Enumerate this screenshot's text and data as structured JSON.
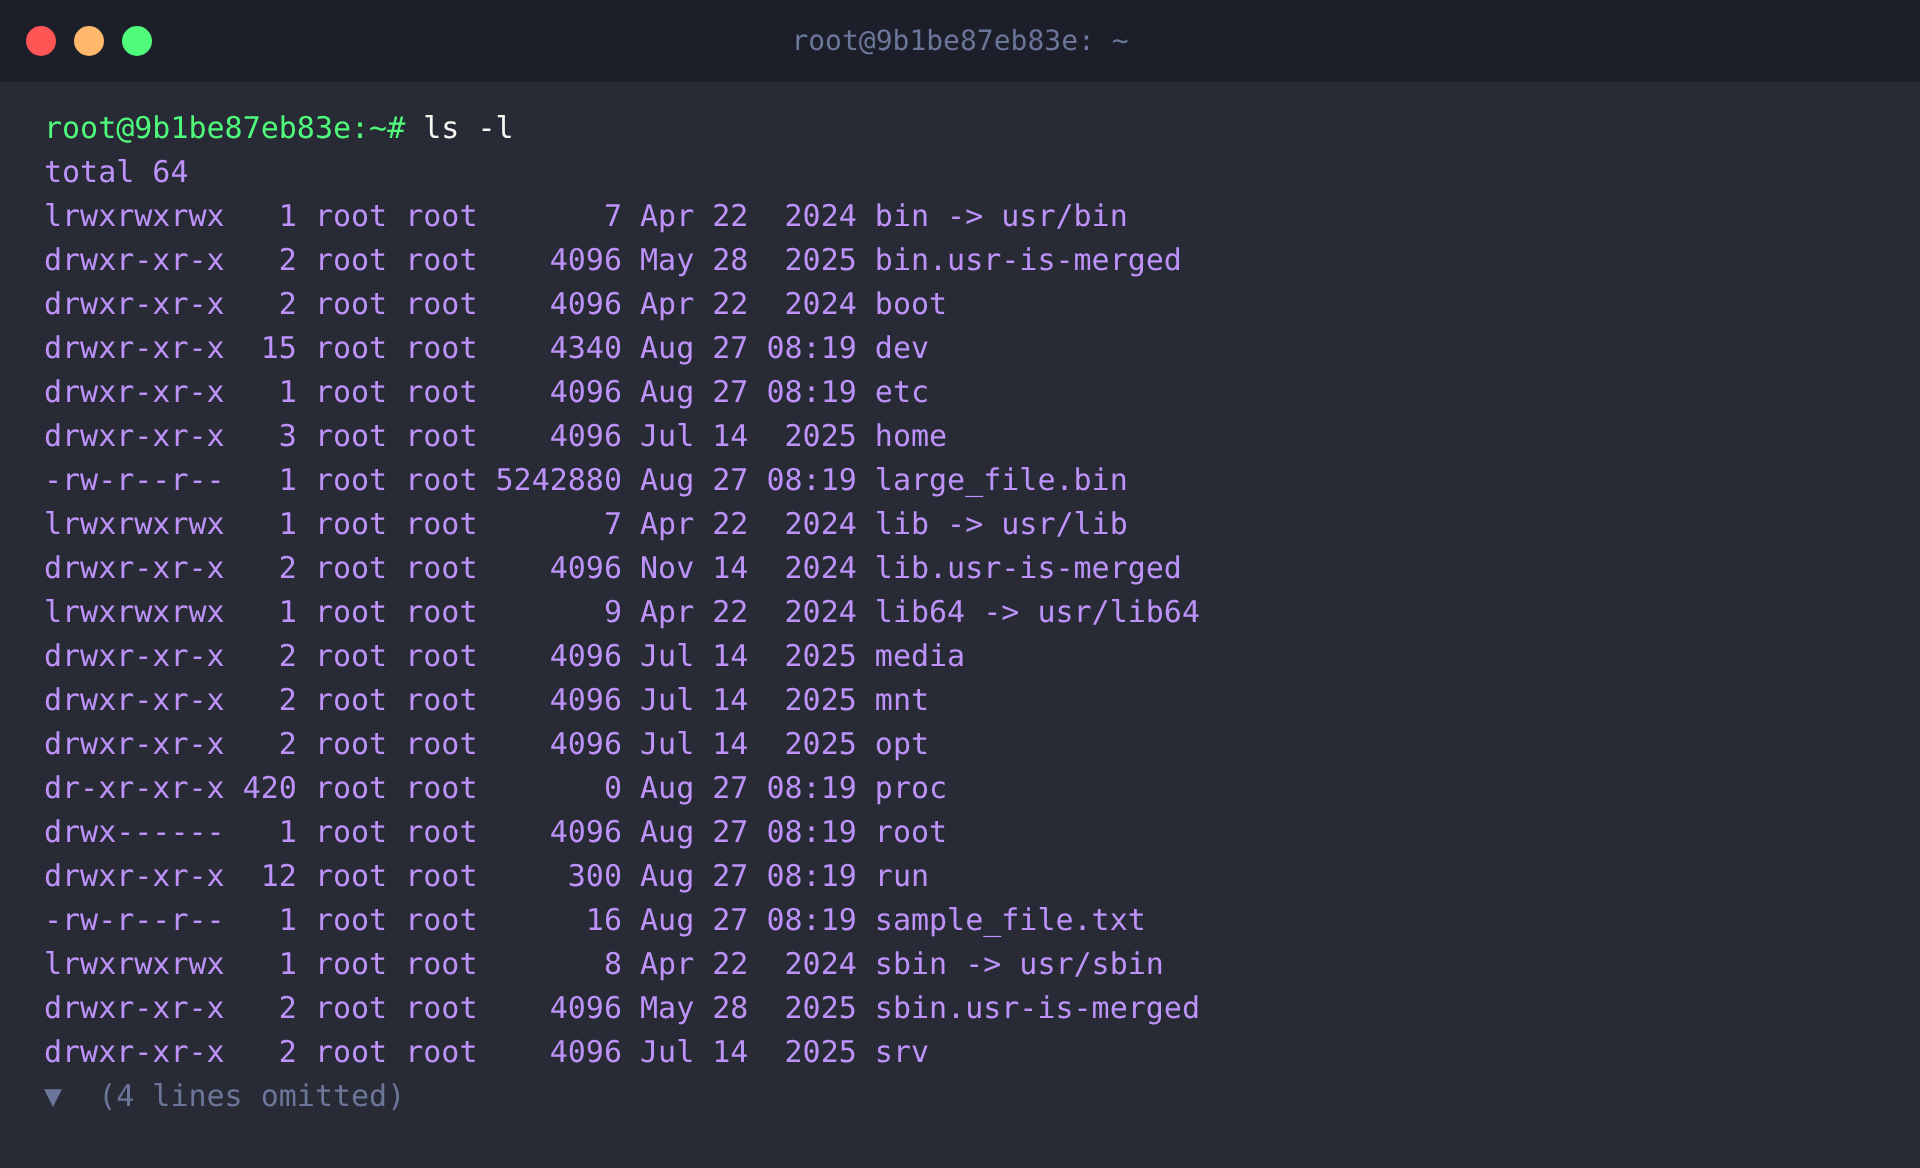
{
  "window": {
    "title": "root@9b1be87eb83e: ~"
  },
  "prompt": {
    "user": "root@9b1be87eb83e:~#",
    "command": "ls -l"
  },
  "output": [
    "total 64",
    "lrwxrwxrwx   1 root root       7 Apr 22  2024 bin -> usr/bin",
    "drwxr-xr-x   2 root root    4096 May 28  2025 bin.usr-is-merged",
    "drwxr-xr-x   2 root root    4096 Apr 22  2024 boot",
    "drwxr-xr-x  15 root root    4340 Aug 27 08:19 dev",
    "drwxr-xr-x   1 root root    4096 Aug 27 08:19 etc",
    "drwxr-xr-x   3 root root    4096 Jul 14  2025 home",
    "-rw-r--r--   1 root root 5242880 Aug 27 08:19 large_file.bin",
    "lrwxrwxrwx   1 root root       7 Apr 22  2024 lib -> usr/lib",
    "drwxr-xr-x   2 root root    4096 Nov 14  2024 lib.usr-is-merged",
    "lrwxrwxrwx   1 root root       9 Apr 22  2024 lib64 -> usr/lib64",
    "drwxr-xr-x   2 root root    4096 Jul 14  2025 media",
    "drwxr-xr-x   2 root root    4096 Jul 14  2025 mnt",
    "drwxr-xr-x   2 root root    4096 Jul 14  2025 opt",
    "dr-xr-xr-x 420 root root       0 Aug 27 08:19 proc",
    "drwx------   1 root root    4096 Aug 27 08:19 root",
    "drwxr-xr-x  12 root root     300 Aug 27 08:19 run",
    "-rw-r--r--   1 root root      16 Aug 27 08:19 sample_file.txt",
    "lrwxrwxrwx   1 root root       8 Apr 22  2024 sbin -> usr/sbin",
    "drwxr-xr-x   2 root root    4096 May 28  2025 sbin.usr-is-merged",
    "drwxr-xr-x   2 root root    4096 Jul 14  2025 srv"
  ],
  "fold": {
    "arrow": "▼",
    "text": "(4 lines omitted)"
  }
}
